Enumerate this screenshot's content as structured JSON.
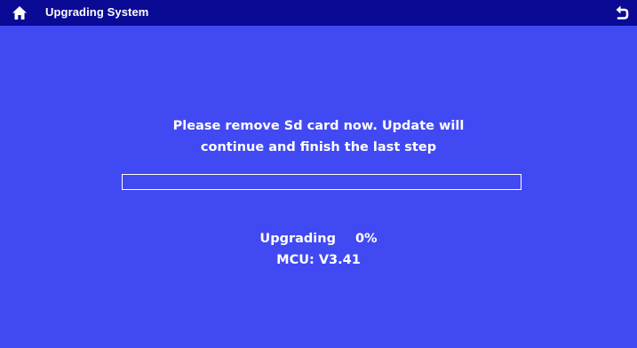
{
  "header": {
    "title": "Upgrading System",
    "home_icon": "home-icon",
    "back_icon": "back-arrow-icon"
  },
  "message": {
    "line1": "Please remove Sd card now. Update will",
    "line2": "continue and finish the last step"
  },
  "progress": {
    "percent": 0
  },
  "status": {
    "label": "Upgrading",
    "percent_text": "0%",
    "version": "MCU: V3.41"
  },
  "colors": {
    "background": "#4149f2",
    "titlebar": "#0a0a95",
    "text": "#ffffff"
  }
}
